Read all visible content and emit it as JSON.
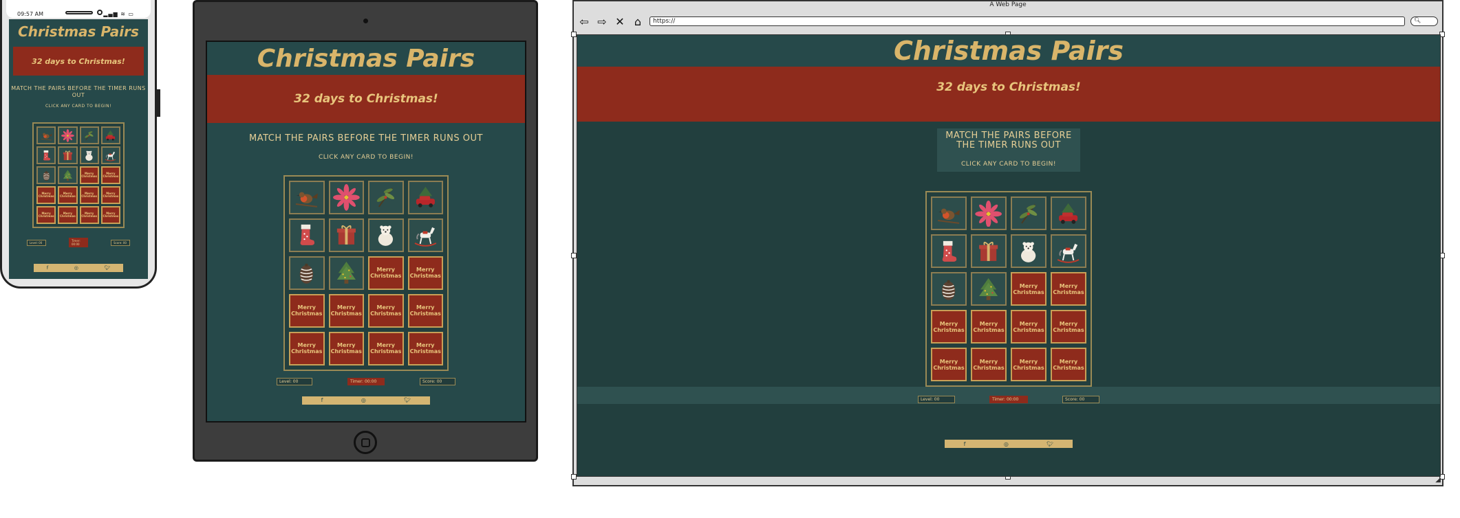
{
  "game": {
    "title": "Christmas Pairs",
    "countdown": "32 days to Christmas!",
    "instruction_main": "MATCH THE PAIRS BEFORE THE TIMER RUNS OUT",
    "instruction_sub": "CLICK ANY CARD TO BEGIN!",
    "card_back_text": "Merry Christmas",
    "revealed_cards": [
      "robin-card",
      "poinsettia-card",
      "holly-sprig-card",
      "red-car-tree-card",
      "stocking-card",
      "gift-box-card",
      "polar-bear-card",
      "rocking-horse-card",
      "pinecone-card",
      "christmas-tree-card"
    ],
    "hidden_card_count": 10,
    "level_label": "Level: 00",
    "timer_label": "Timer: 00:00",
    "score_label": "Score: 00",
    "footer_icons": [
      "facebook-icon",
      "instagram-icon",
      "twitter-icon"
    ]
  },
  "phone": {
    "time": "09:57 AM"
  },
  "browser": {
    "window_title": "A Web Page",
    "url": "https://"
  },
  "colors": {
    "background": "#26494a",
    "banner": "#8e2b1c",
    "gold": "#d9b56a"
  }
}
